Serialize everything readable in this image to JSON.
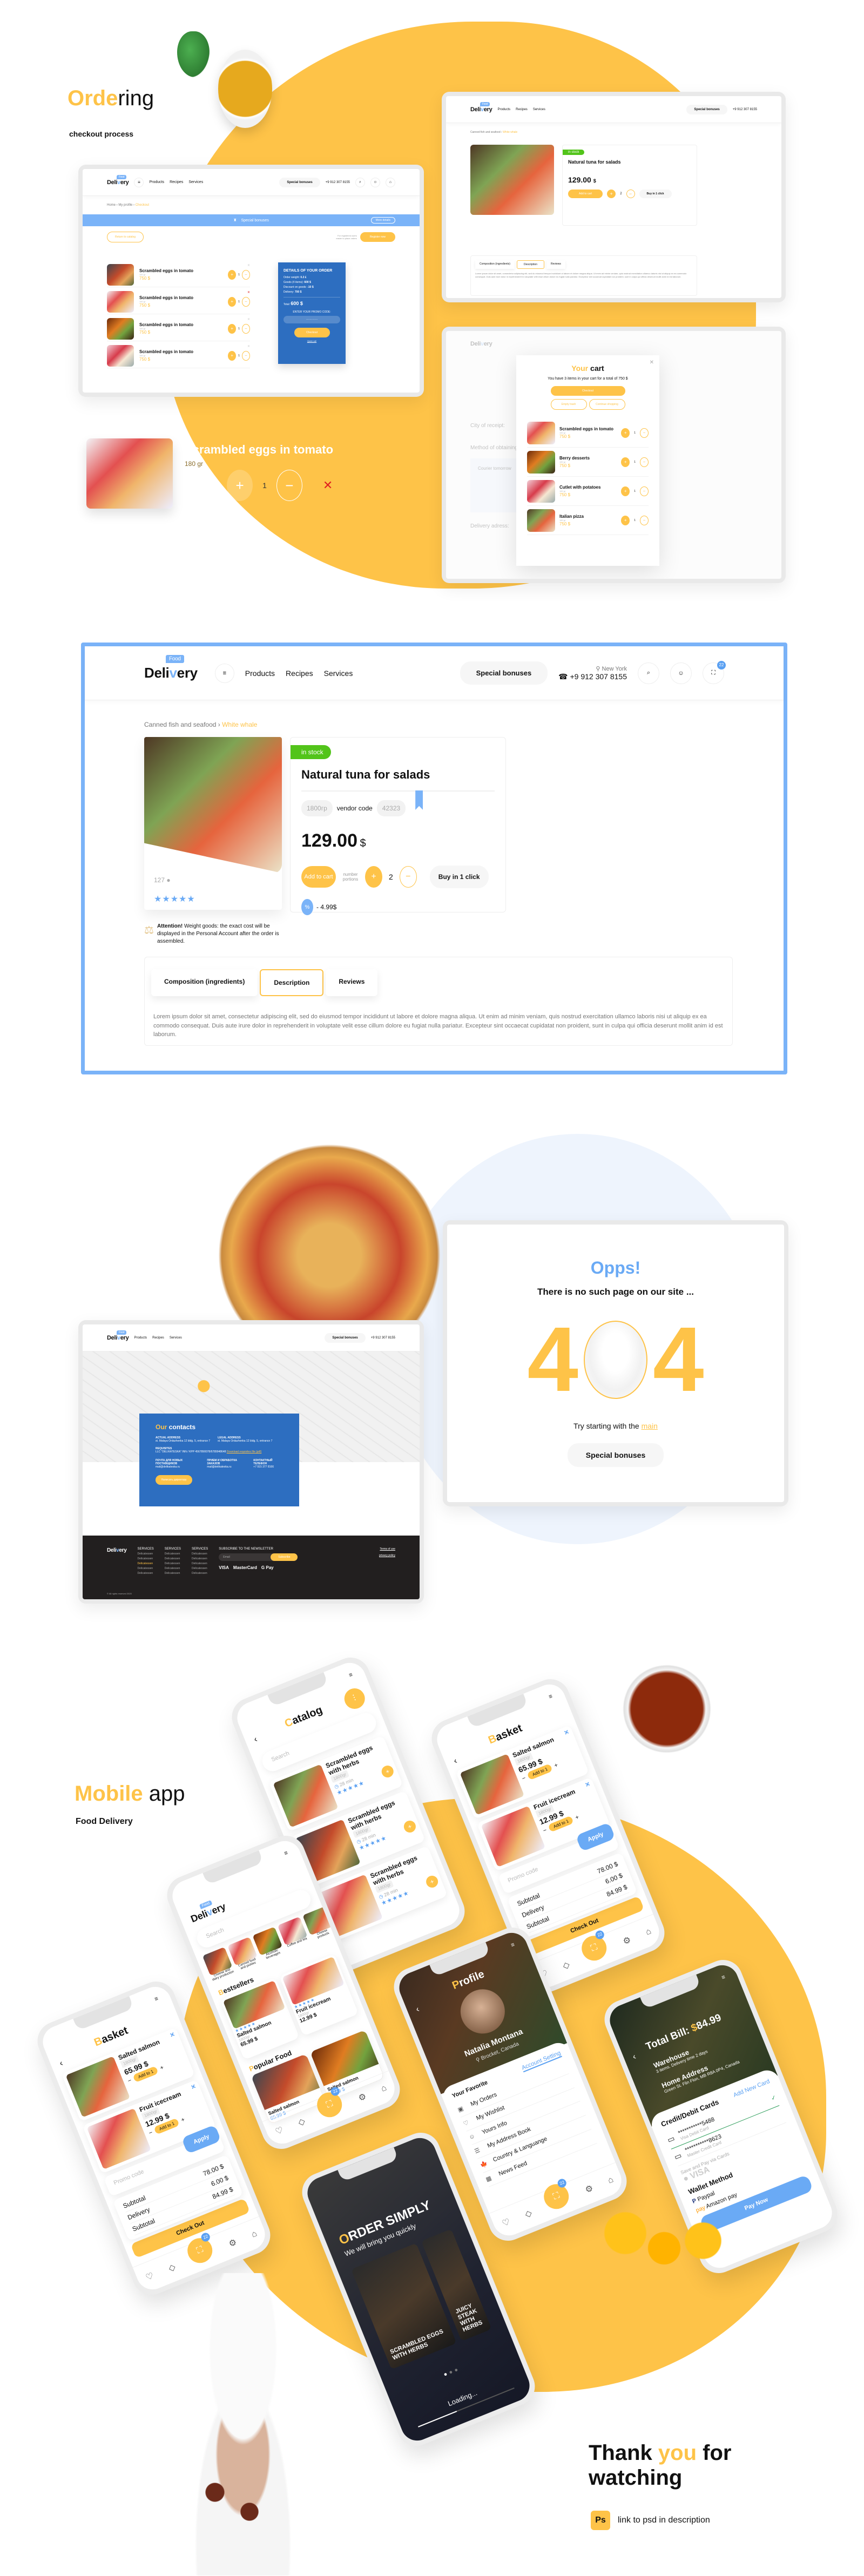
{
  "colors": {
    "accent": "#fec348",
    "blue": "#5aa0f2",
    "dark_blue": "#2d6ec0",
    "delete_red": "#e02020",
    "in_stock": "#52c41a"
  },
  "brand": {
    "logo_text_a": "Deli",
    "logo_text_v": "v",
    "logo_text_b": "ery",
    "logo_tag": "Food"
  },
  "header": {
    "nav": [
      "Products",
      "Recipes",
      "Services"
    ],
    "special_bonuses": "Special bonuses",
    "city": "New York",
    "phone": "+9 912 307 8155",
    "cart_count": "22",
    "icons": [
      "menu-icon",
      "search-icon",
      "user-icon",
      "bag-icon"
    ]
  },
  "intro": {
    "title_accent": "Orde",
    "title_rest": "ring",
    "subtitle": "checkout process"
  },
  "checkout": {
    "breadcrumb": [
      "Home",
      "My profile",
      "Checkout"
    ],
    "bonus_banner": "Special bonuses",
    "bonus_more": "More details",
    "return_label": "Return to catalog",
    "register_note_1": "For registered users",
    "register_note_2": "easier to place orders",
    "register_label": "Register now",
    "portions_label": "number portions",
    "items": [
      {
        "name": "Scrambled eggs in tomato",
        "weight": "180 gr",
        "price": "750 $",
        "qty": "1",
        "delete_active": false
      },
      {
        "name": "Scrambled eggs in tomato",
        "weight": "180 gr",
        "price": "750 $",
        "qty": "1",
        "delete_active": true
      },
      {
        "name": "Scrambled eggs in tomato",
        "weight": "180 gr",
        "price": "750 $",
        "qty": "1",
        "delete_active": false
      },
      {
        "name": "Scrambled eggs in tomato",
        "weight": "180 gr",
        "price": "750 $",
        "qty": "1",
        "delete_active": false
      }
    ],
    "order": {
      "title": "DETAILS OF YOUR ORDER",
      "lines": [
        {
          "label": "Order weight:",
          "value": "0.2 £"
        },
        {
          "label": "Goods (4 items):",
          "value": "600 $"
        },
        {
          "label": "Discount on goods:",
          "value": "-10 $"
        },
        {
          "label": "Delivery:",
          "value": "700 $"
        }
      ],
      "total_label": "Total:",
      "total_value": "600 $",
      "promo_label": "ENTER YOUR PROMO CODE:",
      "promo_value": "·············",
      "checkout_label": "Checkout",
      "quick_call": "Quick call"
    }
  },
  "cart_row": {
    "name": "Scrambled eggs in tomato",
    "weight": "180 gr",
    "price": "750 $",
    "qty": "1"
  },
  "product": {
    "breadcrumb": [
      "Canned fish and seafood",
      "White whale"
    ],
    "stock": "in stock",
    "name": "Natural tuna for salads",
    "weight": "1800гр",
    "vendor_label": "vendor code",
    "vendor_code": "42323",
    "price": "129.00",
    "currency": "$",
    "add_to_cart": "Add to cart",
    "portions_label": "number portions",
    "qty": "2",
    "buy_one_click": "Buy in 1 click",
    "discount": "- 4.99$",
    "comments": "127",
    "rating": 5,
    "attention_bold": "Attention!",
    "attention_text": "Weight goods: the exact cost will be displayed in the Personal Account after the order is assembled.",
    "tabs": [
      "Composition (ingredients)",
      "Description",
      "Reviews"
    ],
    "active_tab": 1,
    "description": "Lorem ipsum dolor sit amet, consectetur adipiscing elit, sed do eiusmod tempor incididunt ut labore et dolore magna aliqua. Ut enim ad minim veniam, quis nostrud exercitation ullamco laboris nisi ut aliquip ex ea commodo consequat. Duis aute irure dolor in reprehenderit in voluptate velit esse cillum dolore eu fugiat nulla pariatur. Excepteur sint occaecat cupidatat non proident, sunt in culpa qui officia deserunt mollit anim id est laborum."
  },
  "cart_modal": {
    "title_accent": "Your",
    "title_rest": "cart",
    "summary": "You have 3 items in your cart for a total of 750 $",
    "checkout": "Checkout",
    "empty": "Empty trash",
    "continue": "Continue shopping",
    "portions_label": "number portions",
    "items": [
      {
        "name": "Scrambled eggs in tomato",
        "weight": "180 gr",
        "price": "750 $",
        "qty": "1"
      },
      {
        "name": "Berry desserts",
        "weight": "180 gr",
        "price": "750 $",
        "qty": "1"
      },
      {
        "name": "Cutlet with potatoes",
        "weight": "180 gr",
        "price": "750 $",
        "qty": "1"
      },
      {
        "name": "Italian pizza",
        "weight": "180 gr",
        "price": "750 $",
        "qty": "1"
      }
    ],
    "bg_labels": [
      "City of receipt:",
      "Method of obtaining:",
      "Courier tomorrow",
      "Delivery adress:"
    ]
  },
  "contacts": {
    "title_accent": "Our",
    "title_rest": "contacts",
    "actual_label": "ACTUAL ADDRESS",
    "actual_value": "st. Malaya Ordazhenka 12 bldg. 5, entrance 7",
    "legal_label": "LEGAL ADDRESS",
    "legal_value": "st. Malaya Ordazhenka 12 bldg. 5, entrance 7",
    "req_label": "REQUISITES",
    "req_value": "LLC \"DELIKATESKA\" INN / KPP 4567890078/6789948648",
    "req_link": "Download requisites file (pdf)",
    "col1_label": "ПОЧТА ДЛЯ НОВЫХ ПОСТАВЩИКОВ",
    "col1_value": "mail@delikateska.ru",
    "col2_label": "ПРИЕМ И ОБРАБОТКА ЗАКАЗОВ",
    "col2_value": "mail@delikateska.ru",
    "col3_label": "КОНТАКТНЫЙ ТЕЛЕФОН",
    "col3_value": "+7 915 377 8166",
    "button": "Написать директору"
  },
  "footer": {
    "columns": [
      {
        "title": "SERVICES",
        "items": [
          "Delicatessen",
          "Delicatessen",
          "Delicatessen",
          "Delicatessen",
          "Delicatessen"
        ],
        "highlight": 2
      },
      {
        "title": "SERVICES",
        "items": [
          "Delicatessen",
          "Delicatessen",
          "Delicatessen",
          "Delicatessen",
          "Delicatessen"
        ],
        "highlight": -1
      },
      {
        "title": "SERVICES",
        "items": [
          "Delicatessen",
          "Delicatessen",
          "Delicatessen",
          "Delicatessen",
          "Delicatessen"
        ],
        "highlight": -1
      }
    ],
    "newsletter": "SUBSCRIBE TO THE NEWSLETTER",
    "email_placeholder": "Email",
    "subscribe": "Subscribe",
    "payments": [
      "VISA",
      "MasterCard",
      "G Pay"
    ],
    "terms": "Terms of use",
    "privacy": "privacy policy",
    "copyright": "© All rights reserved 2020"
  },
  "error404": {
    "title": "Opps!",
    "subtitle": "There is no such page on our site ...",
    "digit_left": "4",
    "digit_right": "4",
    "try_text": "Try starting with the",
    "try_link": "main",
    "button": "Special bonuses"
  },
  "mobile_intro": {
    "title_accent": "Mobile",
    "title_rest": "app",
    "subtitle": "Food Delivery"
  },
  "mobile": {
    "catalog": {
      "title_first": "C",
      "title_rest": "atalog",
      "search": "Search",
      "items": [
        {
          "name": "Scrambled eggs with herbs",
          "weight": "1800gr",
          "time": "28 min",
          "rating": 5
        },
        {
          "name": "Scrambled eggs with herbs",
          "weight": "1800gr",
          "time": "28 min",
          "rating": 5
        },
        {
          "name": "Scrambled eggs with herbs",
          "weight": "1800gr",
          "time": "28 min",
          "rating": 5
        }
      ]
    },
    "home": {
      "search": "Search",
      "categories": [
        "Cheese and dairy production",
        "Canned food and pickles",
        "Alcoholic beverages",
        "Coffee and tea",
        "Cheese products"
      ],
      "bestsellers_first": "B",
      "bestsellers_rest": "estsellers",
      "bestsellers": [
        {
          "name": "Salted salmon",
          "weight": "1800gr",
          "price": "65.99 $"
        },
        {
          "name": "Fruit icecream",
          "weight": "1800gr",
          "price": "12.99 $"
        }
      ],
      "popular_first": "P",
      "popular_rest": "opular Food",
      "popular": [
        {
          "name": "Salted salmon",
          "price": "65.99 $"
        },
        {
          "name": "Salted salmon",
          "price": "65.99 $"
        }
      ]
    },
    "basket": {
      "title_first": "B",
      "title_rest": "asket",
      "items": [
        {
          "name": "Salted salmon",
          "weight": "1800gr",
          "price": "65.99 $",
          "add": "Add to 1"
        },
        {
          "name": "Fruit icecream",
          "weight": "1800gr",
          "price": "12.99 $",
          "add": "Add to 1"
        }
      ],
      "promo": "Promo code",
      "apply": "Apply",
      "totals": [
        {
          "label": "Subtotal",
          "value": "78.00 $"
        },
        {
          "label": "Delivery",
          "value": "6.00 $"
        },
        {
          "label": "Subtotal",
          "value": "84.99 $"
        }
      ],
      "checkout": "Check Out"
    },
    "profile": {
      "title_first": "P",
      "title_rest": "rofile",
      "name": "Natalia Montana",
      "location": "Brocket, Canada",
      "tabs": [
        "Your Favorite",
        "Account Setting"
      ],
      "active_tab": 1,
      "menu": [
        "My Orders",
        "My Wishlist",
        "Yours Info",
        "My Address Book",
        "Country & Languange",
        "News Feed"
      ]
    },
    "payment": {
      "total_label": "Total Bill:",
      "total_currency": "$",
      "total_value": "84.99",
      "warehouse": "Warehouse",
      "warehouse_sub": "3 items. Delivery time 2 days",
      "home": "Home Address",
      "home_sub": "Green St. Flin Flon, MB R8A 0P4, Canada",
      "cards_title": "Credit/Debit Cards",
      "add_card": "Add New Card",
      "cards": [
        {
          "number": "***********5488",
          "type": "Visa Debit Card",
          "selected": true
        },
        {
          "number": "***********8623",
          "type": "Master Credit Card",
          "selected": false
        }
      ],
      "save_pay": "Save and Pay via Cards",
      "wallet_title": "Wallet Method",
      "wallets": [
        "Paypal",
        "Amazon pay"
      ],
      "pay_now": "Pay Now"
    },
    "splash": {
      "title_first": "O",
      "title_rest": "RDER SIMPLY",
      "subtitle": "We will bring you quickly",
      "slides": [
        "SCRAMBLED EGGS WITH HERBS",
        "JUICY STEAK WITH HERBS"
      ],
      "loading": "Loading...",
      "slide_count": 3,
      "active_slide": 0
    },
    "cart_count": "22"
  },
  "outro": {
    "line1_a": "Thank",
    "line1_accent": "you",
    "line1_b": "for",
    "line2": "watching",
    "ps_badge": "Ps",
    "note": "link to psd in description"
  }
}
